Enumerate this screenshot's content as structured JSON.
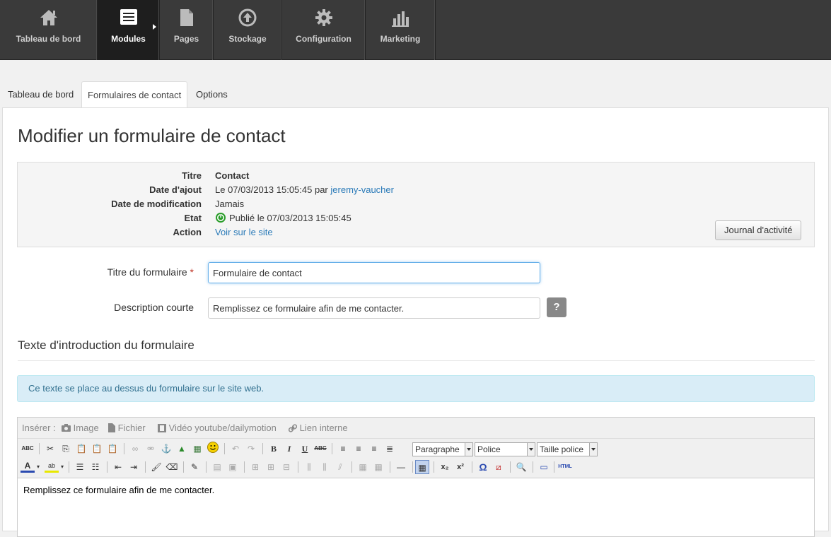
{
  "nav": {
    "items": [
      {
        "label": "Tableau de bord",
        "icon": "home-icon"
      },
      {
        "label": "Modules",
        "icon": "list-icon"
      },
      {
        "label": "Pages",
        "icon": "page-icon"
      },
      {
        "label": "Stockage",
        "icon": "upload-icon"
      },
      {
        "label": "Configuration",
        "icon": "gear-icon"
      },
      {
        "label": "Marketing",
        "icon": "chart-icon"
      }
    ]
  },
  "tabs": [
    {
      "label": "Tableau de bord"
    },
    {
      "label": "Formulaires de contact"
    },
    {
      "label": "Options"
    }
  ],
  "page": {
    "title": "Modifier un formulaire de contact"
  },
  "info": {
    "title_key": "Titre",
    "title_val": "Contact",
    "added_key": "Date d'ajout",
    "added_val": "Le 07/03/2013 15:05:45 par",
    "added_user": "jeremy-vaucher",
    "modified_key": "Date de modification",
    "modified_val": "Jamais",
    "status_key": "Etat",
    "status_val": "Publié le 07/03/2013 15:05:45",
    "action_key": "Action",
    "action_val": "Voir sur le site",
    "journal_button": "Journal d'activité"
  },
  "form": {
    "title_label": "Titre du formulaire",
    "required_mark": "*",
    "title_value": "Formulaire de contact",
    "desc_label": "Description courte",
    "desc_value": "Remplissez ce formulaire afin de me contacter.",
    "help_label": "?"
  },
  "intro": {
    "section_title": "Texte d'introduction du formulaire",
    "notice": "Ce texte se place au dessus du formulaire sur le site web."
  },
  "editor": {
    "insert_label": "Insérer :",
    "insert_image": "Image",
    "insert_file": "Fichier",
    "insert_video": "Vidéo youtube/dailymotion",
    "insert_link": "Lien interne",
    "format_select": "Paragraphe",
    "font_select": "Police",
    "size_select": "Taille police",
    "content": "Remplissez ce formulaire afin de me contacter."
  },
  "colors": {
    "nav_bg": "#3a3a3a",
    "link": "#2a7ab8",
    "status_green": "#2a9d2a"
  }
}
